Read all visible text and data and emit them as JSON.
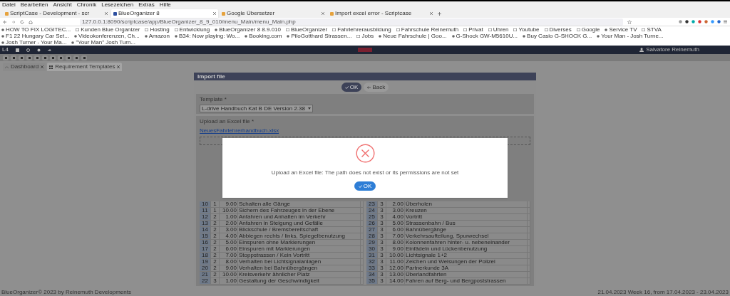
{
  "browser": {
    "menu": [
      "Datei",
      "Bearbeiten",
      "Ansicht",
      "Chronik",
      "Lesezeichen",
      "Extras",
      "Hilfe"
    ],
    "tabs": [
      {
        "label": "ScriptCase - Development - scr",
        "selected": false
      },
      {
        "label": "BlueOrganizer 8",
        "selected": true
      },
      {
        "label": "Google Übersetzer",
        "selected": false
      },
      {
        "label": "Import excel error - Scriptcase",
        "selected": false
      }
    ],
    "url": "127.0.0.1:8090/scriptcase/app/BlueOrganizer_8_9_010/menu_Main/menu_Main.php",
    "bookmarks": [
      {
        "label": "HOW TO FIX LOGITEC...",
        "kind": "site"
      },
      {
        "label": "Kunden Blue Organizer",
        "kind": "folder"
      },
      {
        "label": "Hosting",
        "kind": "folder"
      },
      {
        "label": "Entwicklung",
        "kind": "folder"
      },
      {
        "label": "BlueOrganizer 8 8.9.010",
        "kind": "site"
      },
      {
        "label": "BlueOrganizer",
        "kind": "folder"
      },
      {
        "label": "Fahrlehrerausbildung",
        "kind": "folder"
      },
      {
        "label": "Fahrschule Reinemuth",
        "kind": "folder"
      },
      {
        "label": "Privat",
        "kind": "folder"
      },
      {
        "label": "Uhren",
        "kind": "folder"
      },
      {
        "label": "Youtube",
        "kind": "folder"
      },
      {
        "label": "Diverses",
        "kind": "folder"
      },
      {
        "label": "Google",
        "kind": "folder"
      },
      {
        "label": "Service TV",
        "kind": "site"
      },
      {
        "label": "STVA",
        "kind": "folder"
      },
      {
        "label": "F1 22 Hungary Car Set...",
        "kind": "site"
      },
      {
        "label": "Videokonferenzen, Ch...",
        "kind": "site"
      },
      {
        "label": "Amazon",
        "kind": "site"
      },
      {
        "label": "B34: Now playing: Wo...",
        "kind": "site"
      },
      {
        "label": "Booking.com",
        "kind": "site"
      },
      {
        "label": "PiloGotthard Strassen...",
        "kind": "site"
      },
      {
        "label": "Jobs",
        "kind": "folder"
      },
      {
        "label": "Neue Fahrschule | Goo...",
        "kind": "site"
      },
      {
        "label": "G-Shock GW-M5610U...",
        "kind": "site"
      },
      {
        "label": "Buy Casio G-SHOCK G...",
        "kind": "site"
      },
      {
        "label": "Your Man - Josh Turne...",
        "kind": "site"
      },
      {
        "label": "Josh Turner - Your Ma...",
        "kind": "site"
      },
      {
        "label": "\"Your Man\" Josh Turn...",
        "kind": "site"
      }
    ]
  },
  "app": {
    "version": "L4",
    "user": "Salvatore Reinemuth",
    "tabs": [
      {
        "label": "Dashboard",
        "selected": false
      },
      {
        "label": "Requirement Templates",
        "selected": true
      }
    ]
  },
  "import_panel": {
    "title": "Import file",
    "buttons": [
      {
        "label": "OK",
        "kind": "primary"
      },
      {
        "label": "Back",
        "kind": "secondary"
      }
    ],
    "template_label": "Template *",
    "template_value": "L-drive Handbuch Kat B DE Version 2.38",
    "upload_label": "Upload an Excel file *",
    "upload_file": "NeuesFahrlehrerhandbuch.xlsx",
    "sheet_rows": [
      [
        "10",
        "1",
        "9.00",
        "Schalten alle Gänge"
      ],
      [
        "11",
        "1",
        "10.00",
        "Sichern des Fahrzeuges in der Ebene"
      ],
      [
        "12",
        "2",
        "1.00",
        "Anfahren und Anhalten im Verkehr"
      ],
      [
        "13",
        "2",
        "2.00",
        "Anfahren in Steigung und Gefälle"
      ],
      [
        "14",
        "2",
        "3.00",
        "Blickschule / Bremsbereitschaft"
      ],
      [
        "15",
        "2",
        "4.00",
        "Abbiegen rechts / links, Spiegelbenutzung"
      ],
      [
        "16",
        "2",
        "5.00",
        "Einspuren ohne Markierungen"
      ],
      [
        "17",
        "2",
        "6.00",
        "Einspuren mit Markierungen"
      ],
      [
        "18",
        "2",
        "7.00",
        "Stoppstrassen / Kein Vortritt"
      ],
      [
        "19",
        "2",
        "8.00",
        "Verhalten bei Lichtsignalanlagen"
      ],
      [
        "20",
        "2",
        "9.00",
        "Verhalten bei Bahnübergängen"
      ],
      [
        "21",
        "2",
        "10.00",
        "Kreisverkehr ähnlicher Platz"
      ],
      [
        "22",
        "3",
        "1.00",
        "Gestaltung der Geschwindigkeit"
      ],
      [
        "23",
        "3",
        "2.00",
        "Überholen"
      ],
      [
        "24",
        "3",
        "3.00",
        "Kreuzen"
      ],
      [
        "25",
        "3",
        "4.00",
        "Vortritt"
      ],
      [
        "26",
        "3",
        "5.00",
        "Strassenbahn / Bus"
      ],
      [
        "27",
        "3",
        "6.00",
        "Bahnübergänge"
      ],
      [
        "28",
        "3",
        "7.00",
        "Verkehrsaufteilung, Spurwechsel"
      ],
      [
        "29",
        "3",
        "8.00",
        "Kolonnenfahren hinter- u. nebeneinander"
      ],
      [
        "30",
        "3",
        "9.00",
        "Einfädeln und Lückenbenutzung"
      ],
      [
        "31",
        "3",
        "10.00",
        "Lichtsignale 1+2"
      ],
      [
        "32",
        "3",
        "11.00",
        "Zeichen und Weisungen der Polizei"
      ],
      [
        "33",
        "3",
        "12.00",
        "Partnerkunde 3A"
      ],
      [
        "34",
        "3",
        "13.00",
        "Überlandfahrten"
      ],
      [
        "35",
        "3",
        "14.00",
        "Fahren auf Berg- und Bergpoststrassen"
      ]
    ]
  },
  "dialog": {
    "message": "Upload an Excel file: The path does not exist or its permissions are not set",
    "button": "OK"
  },
  "footer": {
    "left": "BlueOrganizer© 2023 by Reinemuth Developments",
    "right": "21.04.2023 Week 16, from 17.04.2023 - 23.04.2023"
  }
}
